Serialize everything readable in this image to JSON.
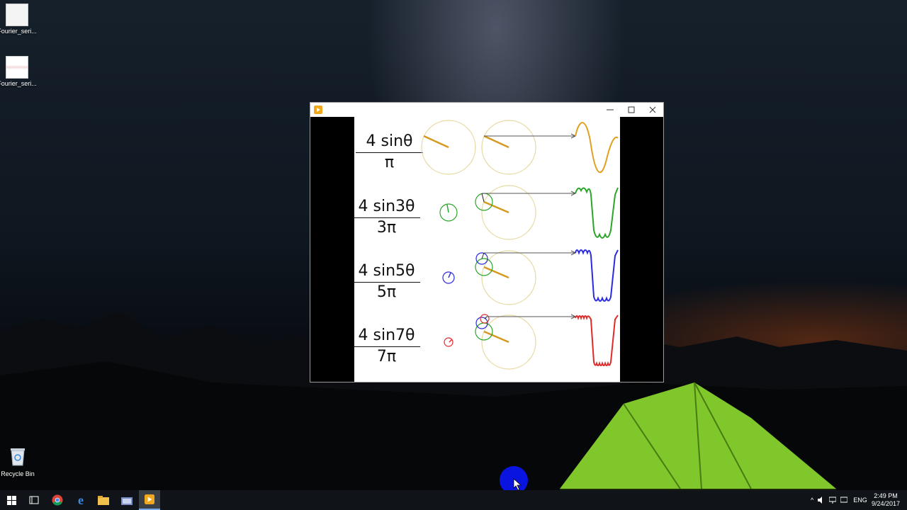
{
  "desktop": {
    "icons": [
      {
        "label": "Fourier_seri...",
        "icon": "document-icon"
      },
      {
        "label": "Fourier_seri...",
        "icon": "image-icon"
      },
      {
        "label": "Recycle Bin",
        "icon": "recycle-bin-icon"
      }
    ]
  },
  "window": {
    "icon": "media-player-icon",
    "controls": {
      "minimize": "minimize-icon",
      "maximize": "maximize-icon",
      "close": "close-icon"
    }
  },
  "formulas": [
    {
      "numerator": "4 sinθ",
      "denominator": "π",
      "color": "#e0a020"
    },
    {
      "numerator": "4 sin3θ",
      "denominator": "3π",
      "color": "#2aa52a"
    },
    {
      "numerator": "4 sin5θ",
      "denominator": "5π",
      "color": "#2a2ae0"
    },
    {
      "numerator": "4 sin7θ",
      "denominator": "7π",
      "color": "#e02a2a"
    }
  ],
  "colors": {
    "main_circle": "#e6d9a0",
    "main_radius": "#d49a20",
    "connector": "#555555",
    "cursor_halo": "#0a14e0"
  },
  "taskbar": {
    "apps": [
      "windows-start-icon",
      "task-view-icon",
      "chrome-icon",
      "edge-icon",
      "file-explorer-icon",
      "folder-icon",
      "media-player-icon"
    ],
    "tray": {
      "language": "ENG"
    },
    "clock": {
      "time": "2:49 PM",
      "date": "9/24/2017"
    }
  }
}
